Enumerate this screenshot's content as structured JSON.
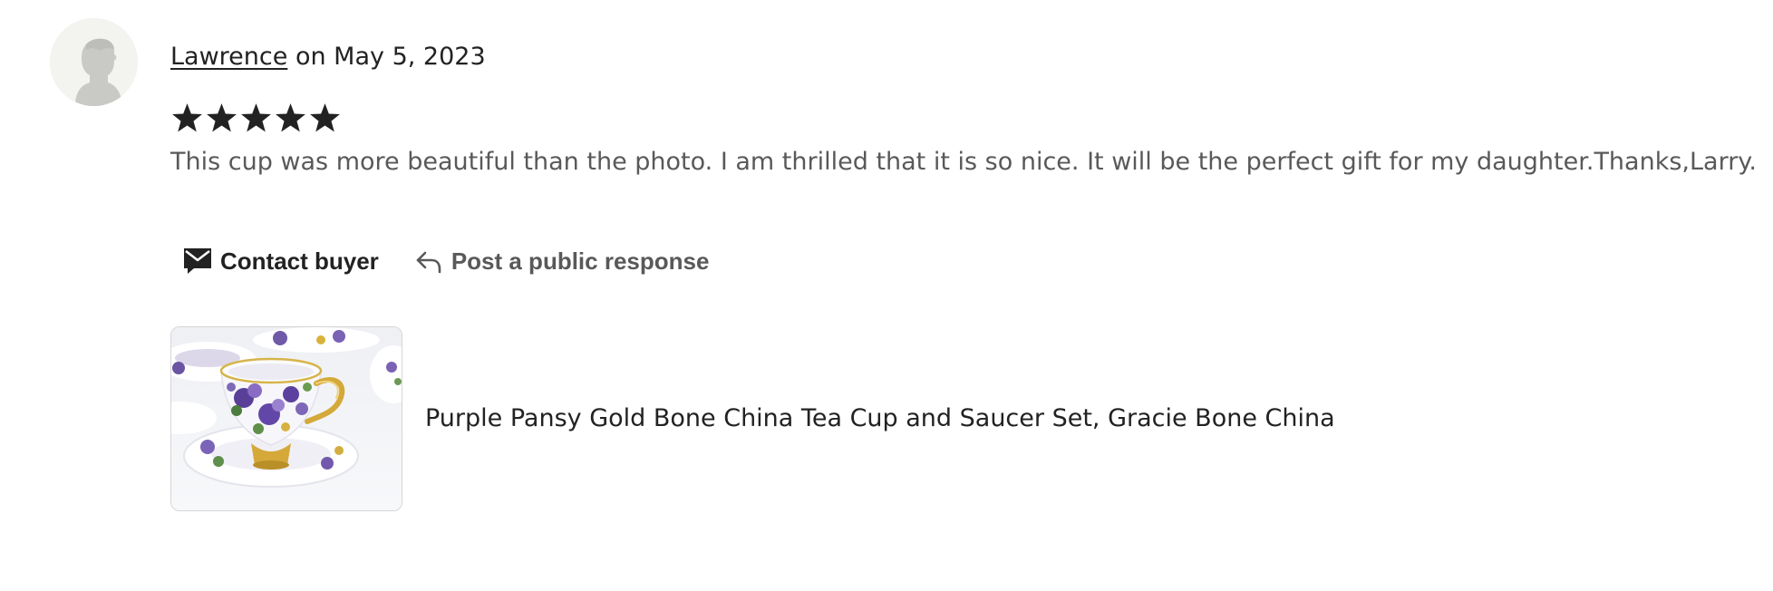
{
  "review": {
    "reviewer_name": "Lawrence",
    "date_text": "on May 5, 2023",
    "rating": 5,
    "rating_max": 5,
    "text": "This cup was more beautiful than the photo. I am thrilled that it is so nice. It will be the perfect gift for my daughter.Thanks,Larry."
  },
  "actions": {
    "contact_label": "Contact buyer",
    "contact_icon": "envelope-icon",
    "respond_label": "Post a public response",
    "respond_icon": "reply-arrow-icon"
  },
  "product": {
    "title": "Purple Pansy Gold Bone China Tea Cup and Saucer Set, Gracie Bone China"
  },
  "colors": {
    "text_primary": "#222222",
    "text_secondary": "#595959",
    "star": "#222222",
    "avatar_bg": "#f3f3ef",
    "avatar_silhouette": "#c9c9c6"
  }
}
